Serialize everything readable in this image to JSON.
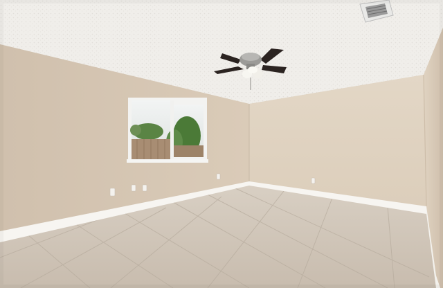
{
  "scene": {
    "subject": "empty-room",
    "colors": {
      "ceiling": "#f1efec",
      "wall_left": "#d4c5b3",
      "wall_back": "#e1d4c2",
      "wall_right": "#ddcfbd",
      "baseboard": "#f7f5f1",
      "floor": "#cfc4b7",
      "tile_line": "#b7ac9f",
      "window_frame": "#f2f2f0",
      "sky": "#e6eaea",
      "trees": "#4e7b3b",
      "fence": "#a78b71",
      "fan_metal": "#8b8a88",
      "fan_blade": "#2a2321"
    }
  }
}
